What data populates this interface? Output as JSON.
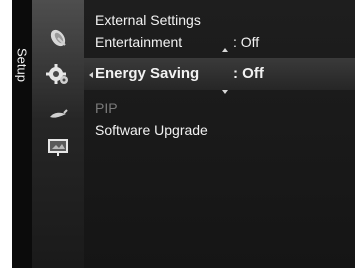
{
  "sidebar": {
    "tab_label": "Setup",
    "icons": [
      "satellite-dish-icon",
      "gear-icon",
      "chili-pepper-icon",
      "input-display-icon"
    ]
  },
  "menu": {
    "items": [
      {
        "label": "External Settings",
        "value": "",
        "state": "normal"
      },
      {
        "label": "Entertainment",
        "value": ": Off",
        "state": "normal"
      },
      {
        "label": "Energy Saving",
        "value": ": Off",
        "state": "selected"
      },
      {
        "label": "PIP",
        "value": "",
        "state": "disabled"
      },
      {
        "label": "Software Upgrade",
        "value": "",
        "state": "normal"
      }
    ]
  },
  "colors": {
    "background": "#070707",
    "text": "#f2f2f2",
    "disabled_text": "#7a7a7a",
    "highlight": "#303030"
  }
}
